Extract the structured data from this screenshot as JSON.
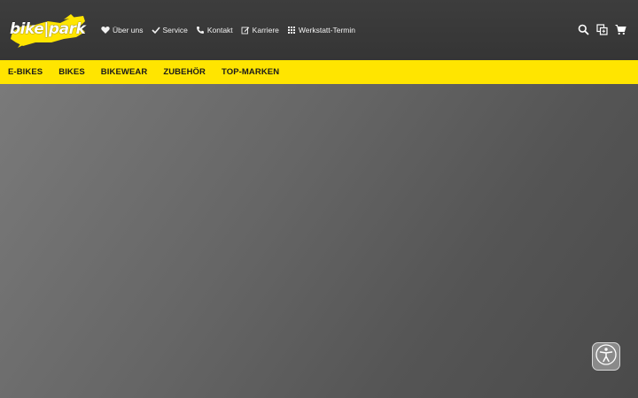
{
  "logo": {
    "text": "bike|park",
    "colors": {
      "splash": "#ffe500",
      "text": "#ffffff"
    }
  },
  "service_nav": [
    {
      "label": "Über uns",
      "icon": "heart-icon"
    },
    {
      "label": "Service",
      "icon": "check-icon"
    },
    {
      "label": "Kontakt",
      "icon": "phone-icon"
    },
    {
      "label": "Karriere",
      "icon": "edit-icon"
    },
    {
      "label": "Werkstatt-Termin",
      "icon": "grid-icon"
    }
  ],
  "utility_icons": [
    "search-icon",
    "compare-icon",
    "cart-icon"
  ],
  "main_nav": [
    "E-BIKES",
    "BIKES",
    "BIKEWEAR",
    "ZUBEHÖR",
    "TOP-MARKEN"
  ],
  "accessibility_button": {
    "icon": "accessibility-icon"
  },
  "colors": {
    "topbar": "#383838",
    "accent": "#ffe500",
    "hero": "#616161"
  }
}
